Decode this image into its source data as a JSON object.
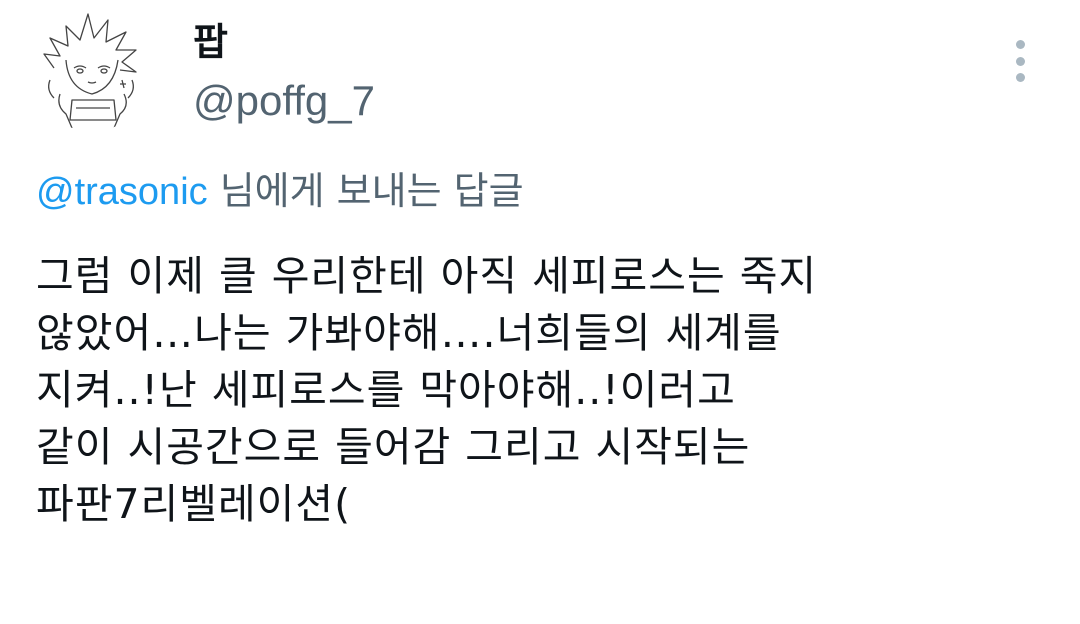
{
  "tweet": {
    "author": {
      "display_name": "팝",
      "handle": "@poffg_7",
      "avatar_icon": "anime-sketch-avatar-icon"
    },
    "more_icon": "more-vertical-icon",
    "reply_to": {
      "mention": "@trasonic",
      "suffix": " 님에게 보내는 답글"
    },
    "body_lines": [
      "그럼 이제 클 우리한테 아직 세피로스는 죽지",
      "않았어…나는 가봐야해….너희들의 세계를",
      "지켜..!난 세피로스를 막아야해..!이러고",
      "같이 시공간으로 들어감 그리고 시작되는",
      "파판7리벨레이션("
    ]
  },
  "colors": {
    "text": "#0f1419",
    "secondary": "#536471",
    "link": "#1d9bf0",
    "more_dots": "#aab8c2"
  }
}
